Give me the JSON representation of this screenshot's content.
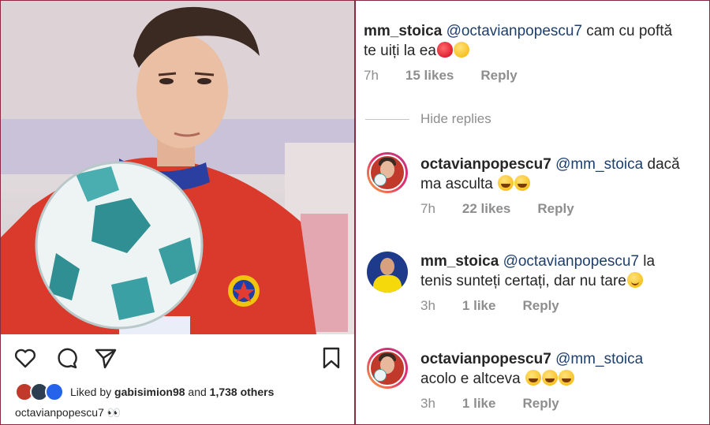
{
  "post": {
    "liked_by_prefix": "Liked by ",
    "liked_by_user": "gabisimion98",
    "liked_by_suffix": " and ",
    "liked_by_count": "1,738 others",
    "caption_user": "octavianpopescu7",
    "caption_text": " 👀"
  },
  "comments": [
    {
      "user": "mm_stoica",
      "mention": "@octavianpopescu7",
      "text_line1": " cam cu poftă",
      "text_line2": "te uiți la ea",
      "time": "7h",
      "likes": "15 likes",
      "reply": "Reply"
    },
    {
      "user": "octavianpopescu7",
      "mention": "@mm_stoica",
      "text_line1": " dacă",
      "text_line2": "ma asculta",
      "time": "7h",
      "likes": "22 likes",
      "reply": "Reply"
    },
    {
      "user": "mm_stoica",
      "mention": "@octavianpopescu7",
      "text_line1": " la",
      "text_line2": "tenis sunteți certați, dar nu tare",
      "time": "3h",
      "likes": "1 like",
      "reply": "Reply"
    },
    {
      "user": "octavianpopescu7",
      "mention": "@mm_stoica",
      "text_line1": "",
      "text_line2": "acolo e altceva",
      "time": "3h",
      "likes": "1 like",
      "reply": "Reply"
    }
  ],
  "hide_replies": "Hide replies",
  "icons": [
    "heart-icon",
    "comment-icon",
    "share-icon",
    "bookmark-icon"
  ],
  "colors": {
    "mention": "#1d3f6e",
    "meta": "#8e8e8e",
    "border": "#8a2a3e"
  }
}
